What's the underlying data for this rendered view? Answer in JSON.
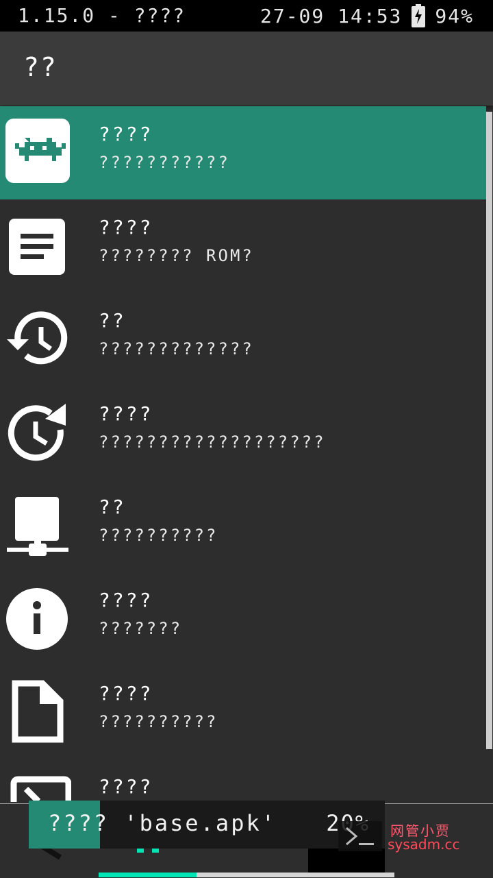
{
  "status_bar": {
    "version": "1.15.0 - ????",
    "datetime": "27-09 14:53",
    "battery_icon": "battery-charging-icon",
    "battery_percent": "94%"
  },
  "header": {
    "title": "??"
  },
  "menu": {
    "items": [
      {
        "icon": "retroarch-invader-icon",
        "title": "????",
        "subtitle": "???????????"
      },
      {
        "icon": "document-lines-icon",
        "title": "????",
        "subtitle": "???????? ROM?"
      },
      {
        "icon": "history-icon",
        "title": "??",
        "subtitle": "?????????????"
      },
      {
        "icon": "clock-refresh-icon",
        "title": "????",
        "subtitle": "???????????????????"
      },
      {
        "icon": "network-icon",
        "title": "??",
        "subtitle": "??????????"
      },
      {
        "icon": "info-icon",
        "title": "????",
        "subtitle": "???????"
      },
      {
        "icon": "file-icon",
        "title": "????",
        "subtitle": "??????????"
      },
      {
        "icon": "exit-icon",
        "title": "????",
        "subtitle": ""
      }
    ],
    "selected_index": 0
  },
  "toast": {
    "text": "???? 'base.apk'",
    "percent": "20%"
  },
  "download_progress": 0.33,
  "watermark": {
    "line1": "网管小贾",
    "line2": "sysadm.cc"
  },
  "colors": {
    "accent": "#258a73",
    "background": "#2d2d2d",
    "header": "#3b3b3b",
    "progress": "#00e5b4"
  }
}
